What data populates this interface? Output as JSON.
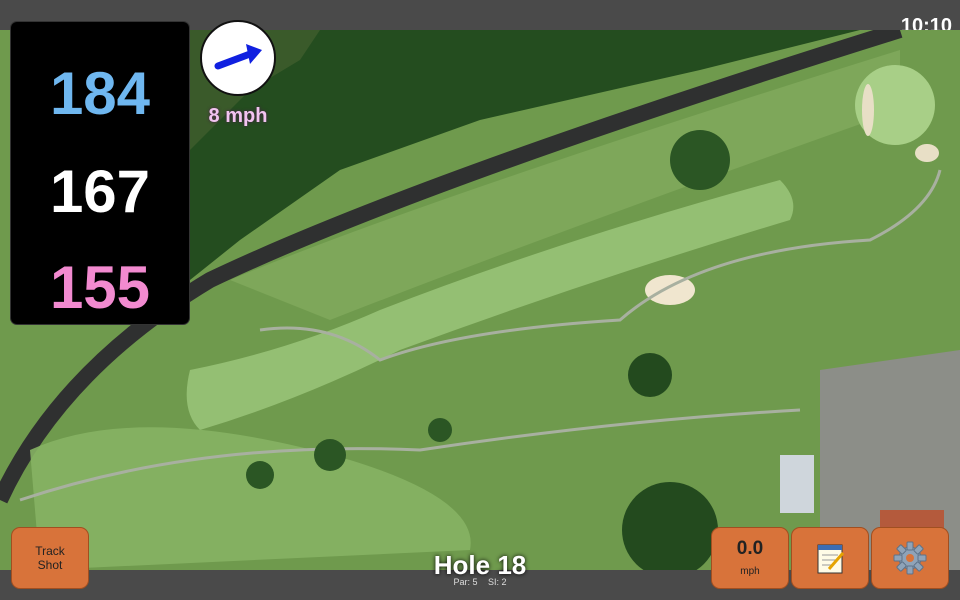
{
  "status_bar": {
    "time": "10:10"
  },
  "yardages": {
    "back": "184",
    "middle": "167",
    "front": "155"
  },
  "wind": {
    "speed": "8 mph",
    "direction_icon": "arrow-east-northeast"
  },
  "buttons": {
    "track_line1": "Track",
    "track_line2": "Shot",
    "notes_icon": "notepad-icon",
    "settings_icon": "gear-icon"
  },
  "speed": {
    "value": "0.0",
    "unit": "mph"
  },
  "hole": {
    "title": "Hole 18",
    "par_label": "Par: 5",
    "si_label": "SI: 2"
  },
  "colors": {
    "back": "#6fb7f0",
    "middle": "#ffffff",
    "front": "#f28ad0",
    "button": "#d8733a",
    "wind_text": "#f2c4f0"
  }
}
